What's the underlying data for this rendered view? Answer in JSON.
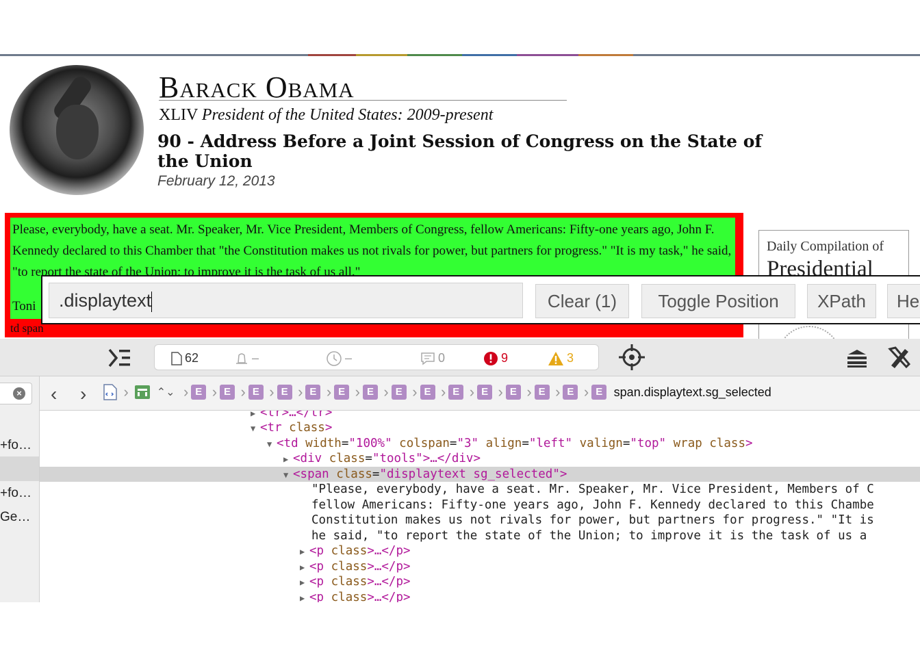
{
  "webpage": {
    "president_name": "Barack Obama",
    "president_subtitle_roman": "XLIV",
    "president_subtitle_italic": "President of the United States: 2009-present",
    "document_title": "90 - Address Before a Joint Session of Congress on the State of the Union",
    "document_date": "February 12, 2013",
    "speech_text": "Please, everybody, have a seat. Mr. Speaker, Mr. Vice President, Members of Congress, fellow Americans: Fifty-one years ago, John F. Kennedy declared to this Chamber that \"the Constitution makes us not rivals for power, but partners for progress.\" \"It is my task,\" he said, \"to report the state of the Union; to improve it is the task of us all.\"",
    "speech_continuation": "Toni",
    "selection_label": "td span",
    "sidebar_box_line1": "Daily Compilation of",
    "sidebar_box_line2": "Presidential",
    "highlight_colors": {
      "outer": "#ff0000",
      "inner": "#33ff33"
    }
  },
  "selector_gadget": {
    "input_value": ".displaytext",
    "clear_label": "Clear (1)",
    "toggle_label": "Toggle Position",
    "xpath_label": "XPath",
    "help_label": "He"
  },
  "devtools": {
    "toolbar": {
      "resources_count": "62",
      "requests_count": "–",
      "time_value": "–",
      "messages_count": "0",
      "errors_count": "9",
      "warnings_count": "3",
      "error_color": "#d0021b",
      "warning_color": "#e6a817"
    },
    "breadcrumb": {
      "e_label": "E",
      "final_label": "span.displaytext.sg_selected"
    },
    "left_panel_items": [
      "+fo…",
      "+fo…",
      "Ge…"
    ],
    "dom_lines": {
      "l0_tag": "<tr>…</tr>",
      "l1_open": "<tr",
      "l1_attr": "class",
      "l1_close": ">",
      "l2_open": "<td",
      "l2_a1": "width",
      "l2_v1": "\"100%\"",
      "l2_a2": "colspan",
      "l2_v2": "\"3\"",
      "l2_a3": "align",
      "l2_v3": "\"left\"",
      "l2_a4": "valign",
      "l2_v4": "\"top\"",
      "l2_a5": "wrap",
      "l2_a6": "class",
      "l2_close": ">",
      "l3_open": "<div",
      "l3_a1": "class",
      "l3_v1": "\"tools\"",
      "l3_close": ">…</div>",
      "l4_open": "<span",
      "l4_a1": "class",
      "l4_v1": "\"displaytext sg_selected\"",
      "l4_close": ">",
      "text_lines": [
        "\"Please, everybody, have a seat. Mr. Speaker, Mr. Vice President, Members of C",
        "fellow Americans: Fifty-one years ago, John F. Kennedy declared to this Chambe",
        "Constitution makes us not rivals for power, but partners for progress.\" \"It is",
        "he said, \"to report the state of the Union; to improve it is the task of us a"
      ],
      "p_open": "<p",
      "p_attr": "class",
      "p_close": ">…</p>"
    }
  }
}
